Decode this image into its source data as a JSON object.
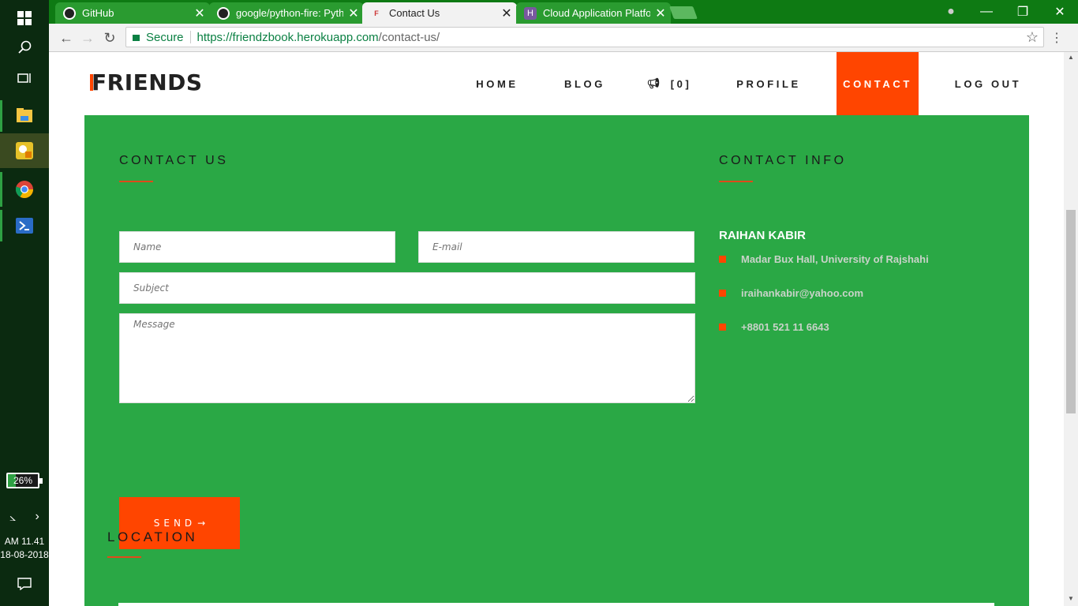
{
  "taskbar": {
    "battery_percent": "26%",
    "battery_level": 0.26,
    "clock_time": "AM 11.41",
    "clock_date": "18-08-2018"
  },
  "tabs": [
    {
      "title": "GitHub",
      "icon": "github-icon"
    },
    {
      "title": "google/python-fire: Pyth",
      "icon": "github-icon"
    },
    {
      "title": "Contact Us",
      "icon": "friends-favicon",
      "active": true
    },
    {
      "title": "Cloud Application Platfor",
      "icon": "heroku-icon"
    }
  ],
  "browser": {
    "secure_label": "Secure",
    "url_host": "https://friendzbook.herokuapp.com",
    "url_path": "/contact-us/"
  },
  "site": {
    "logo": "FRIENDS",
    "nav": {
      "home": "HOME",
      "blog": "BLOG",
      "notifications": "[0]",
      "profile": "PROFILE",
      "contact": "CONTACT",
      "logout": "LOG OUT"
    }
  },
  "contact": {
    "heading": "CONTACT US",
    "name_placeholder": "Name",
    "email_placeholder": "E-mail",
    "subject_placeholder": "Subject",
    "message_placeholder": "Message",
    "send_label": "SEND"
  },
  "info": {
    "heading": "CONTACT INFO",
    "name": "RAIHAN KABIR",
    "address": "Madar Bux Hall, University of Rajshahi",
    "email": "iraihankabir@yahoo.com",
    "phone": "+8801 521 11 6643"
  },
  "location": {
    "heading": "LOCATION"
  },
  "colors": {
    "accent": "#ff4500",
    "section_bg": "#2aa845",
    "tabbar": "#0e7a13"
  }
}
